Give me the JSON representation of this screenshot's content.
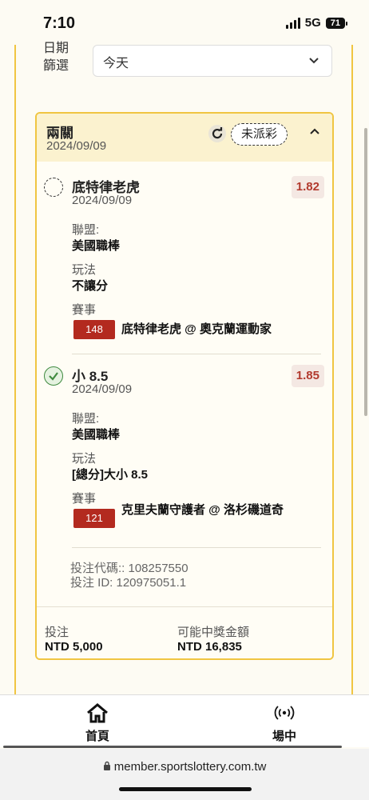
{
  "status_bar": {
    "time": "7:10",
    "network": "5G",
    "battery": "71"
  },
  "filter": {
    "label": "日期篩選",
    "label_line1": "日期",
    "label_line2": "篩選",
    "value": "今天"
  },
  "bet": {
    "type": "兩關",
    "date": "2024/09/09",
    "status": "未派彩",
    "legs": [
      {
        "name": "底特律老虎",
        "date": "2024/09/09",
        "odds": "1.82",
        "selected": false,
        "league_label": "聯盟:",
        "league": "美國職棒",
        "play_label": "玩法",
        "play": "不讓分",
        "event_label": "賽事",
        "event_number": "148",
        "event": "底特律老虎 @ 奧克蘭運動家"
      },
      {
        "name": "小 8.5",
        "date": "2024/09/09",
        "odds": "1.85",
        "selected": true,
        "league_label": "聯盟:",
        "league": "美國職棒",
        "play_label": "玩法",
        "play": "[總分]大小 8.5",
        "event_label": "賽事",
        "event_number": "121",
        "event": "克里夫蘭守護者 @ 洛杉磯道奇"
      }
    ],
    "bet_code": "投注代碼:: 108257550",
    "bet_id": "投注 ID: 120975051.1",
    "stake_label": "投注",
    "stake": "NTD 5,000",
    "payout_label": "可能中獎金額",
    "payout": "NTD 16,835"
  },
  "tabs": [
    {
      "label": "首頁",
      "icon": "home-icon"
    },
    {
      "label": "場中",
      "icon": "live-broadcast-icon"
    }
  ],
  "browser": {
    "url": "member.sportslottery.com.tw"
  }
}
